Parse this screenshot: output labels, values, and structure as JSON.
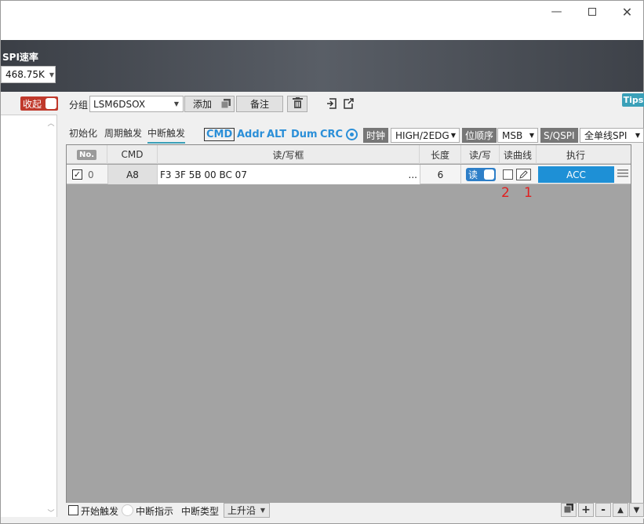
{
  "window": {
    "minimize_icon": "minimize-icon",
    "maximize_icon": "maximize-icon",
    "close_icon": "close-icon"
  },
  "header": {
    "spi_rate_label": "SPI速率",
    "spi_rate_value": "468.75K"
  },
  "left": {
    "collapse_label": "收起"
  },
  "toolbar": {
    "group_label": "分组",
    "group_value": "LSM6DSOX",
    "add_label": "添加",
    "note_label": "备注",
    "tips_label": "Tips"
  },
  "tabs": [
    {
      "label": "初始化"
    },
    {
      "label": "周期触发"
    },
    {
      "label": "中断触发"
    }
  ],
  "options": {
    "cmd": "CMD",
    "addr": "Addr",
    "alt": "ALT",
    "dum": "Dum",
    "crc": "CRC",
    "clock_label": "时钟",
    "clock_value": "HIGH/2EDG",
    "bit_order_label": "位顺序",
    "bit_order_value": "MSB",
    "mode_label": "S/QSPI",
    "mode_value": "全单线SPI"
  },
  "table": {
    "headers": {
      "no": "No.",
      "cmd": "CMD",
      "rw_box": "读/写框",
      "length": "长度",
      "rw": "读/写",
      "curve": "读曲线",
      "exec": "执行"
    },
    "rows": [
      {
        "checked": true,
        "index": "0",
        "cmd": "A8",
        "data": "F3 3F 5B 00 BC 07",
        "ellipsis": "...",
        "length": "6",
        "rw": "读",
        "exec": "ACC"
      }
    ]
  },
  "annotations": {
    "mark2": "2",
    "mark1": "1"
  },
  "bottom": {
    "start_trigger": "开始触发",
    "interrupt_indicator": "中断指示",
    "interrupt_type_label": "中断类型",
    "interrupt_type_value": "上升沿"
  },
  "colors": {
    "accent": "#3aa0b8",
    "exec_button": "#1e90d6",
    "collapse": "#c0392b",
    "annotation": "#e02020"
  }
}
